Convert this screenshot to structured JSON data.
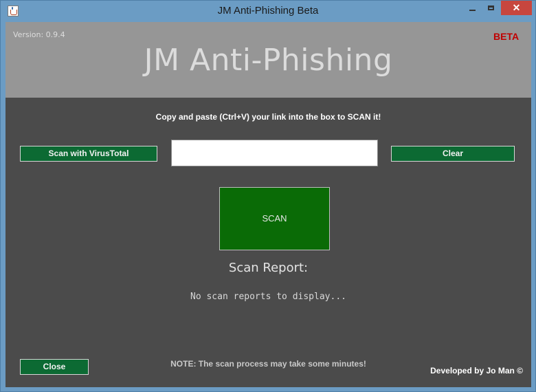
{
  "window": {
    "title": "JM Anti-Phishing Beta",
    "close_glyph": "✕"
  },
  "header": {
    "version": "Version: 0.9.4",
    "badge": "BETA",
    "title": "JM Anti-Phishing"
  },
  "main": {
    "instructions": "Copy and paste (Ctrl+V) your link into the box to SCAN it!",
    "virustotal_label": "Scan with VirusTotal",
    "clear_label": "Clear",
    "url_input": {
      "value": "",
      "placeholder": ""
    },
    "scan_label": "SCAN",
    "report_title": "Scan Report:",
    "report_text": "No scan reports to display..."
  },
  "footer": {
    "close_label": "Close",
    "note": "NOTE: The scan process may take some minutes!",
    "credits": "Developed by Jo Man ©"
  },
  "colors": {
    "header_bg": "#969696",
    "body_bg": "#4b4b4b",
    "button_green": "#0c6a33",
    "scan_green": "#0a6b06",
    "beta_red": "#c00000",
    "titlebar": "#6b9cc4"
  },
  "icons": {
    "app": "java-cup-icon",
    "minimize": "minimize-icon",
    "maximize": "maximize-icon",
    "close": "close-icon"
  }
}
